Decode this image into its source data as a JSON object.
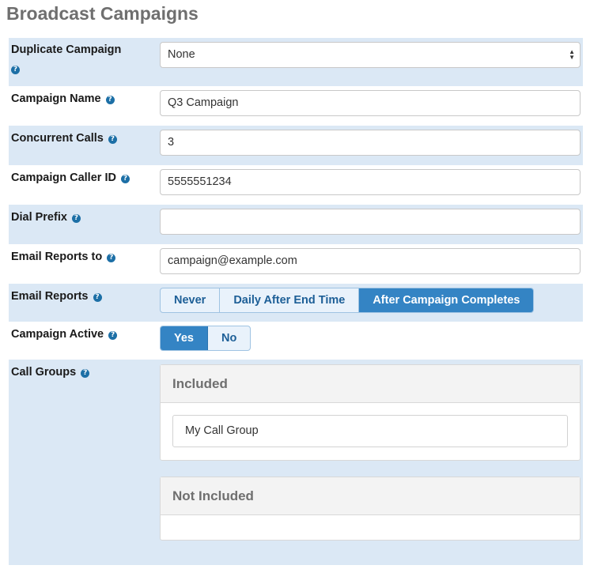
{
  "page": {
    "title": "Broadcast Campaigns"
  },
  "help_glyph": "?",
  "fields": {
    "duplicate_campaign": {
      "label": "Duplicate Campaign",
      "value": "None"
    },
    "campaign_name": {
      "label": "Campaign Name",
      "value": "Q3 Campaign"
    },
    "concurrent_calls": {
      "label": "Concurrent Calls",
      "value": "3"
    },
    "caller_id": {
      "label": "Campaign Caller ID",
      "value": "5555551234"
    },
    "dial_prefix": {
      "label": "Dial Prefix",
      "value": ""
    },
    "email_reports_to": {
      "label": "Email Reports to",
      "value": "campaign@example.com"
    }
  },
  "email_reports": {
    "label": "Email Reports",
    "options": [
      "Never",
      "Daily After End Time",
      "After Campaign Completes"
    ],
    "selected": "After Campaign Completes"
  },
  "campaign_active": {
    "label": "Campaign Active",
    "options": [
      "Yes",
      "No"
    ],
    "selected": "Yes"
  },
  "call_groups": {
    "label": "Call Groups",
    "included": {
      "heading": "Included",
      "items": [
        "My Call Group"
      ]
    },
    "not_included": {
      "heading": "Not Included",
      "items": []
    }
  },
  "colors": {
    "row_shade": "#dbe8f5",
    "accent": "#3484c4",
    "help_icon": "#1c6fa6"
  }
}
